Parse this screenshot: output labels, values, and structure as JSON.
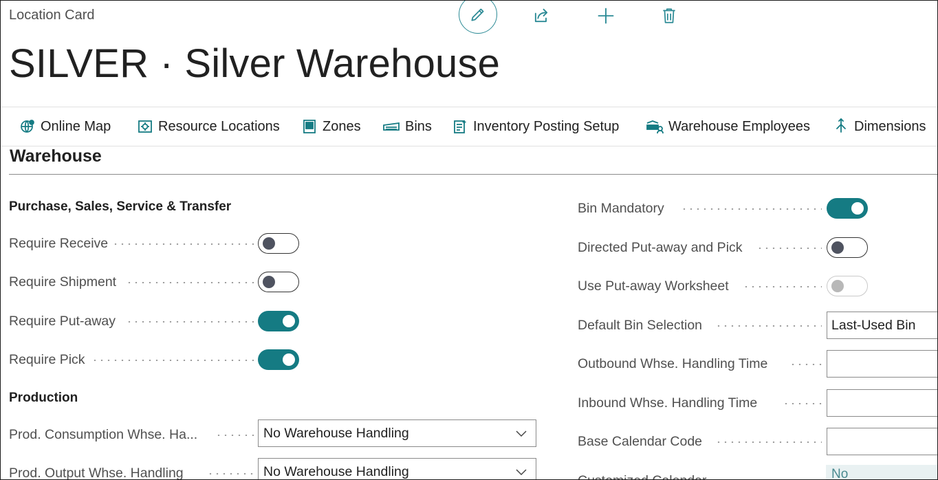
{
  "breadcrumb": "Location Card",
  "actions": {
    "edit": "pencil-icon",
    "share": "share-icon",
    "add": "plus-icon",
    "delete": "trash-icon"
  },
  "title": "SILVER · Silver Warehouse",
  "nav": [
    {
      "label": "Online Map",
      "icon": "globe-map-icon"
    },
    {
      "label": "Resource Locations",
      "icon": "resource-location-icon"
    },
    {
      "label": "Zones",
      "icon": "zones-icon"
    },
    {
      "label": "Bins",
      "icon": "bins-icon"
    },
    {
      "label": "Inventory Posting Setup",
      "icon": "posting-setup-icon"
    },
    {
      "label": "Warehouse Employees",
      "icon": "employees-icon"
    },
    {
      "label": "Dimensions",
      "icon": "dimensions-icon"
    }
  ],
  "section": {
    "title": "Warehouse"
  },
  "left": {
    "group1_title": "Purchase, Sales, Service & Transfer",
    "require_receive": {
      "label": "Require Receive",
      "value": false
    },
    "require_shipment": {
      "label": "Require Shipment",
      "value": false
    },
    "require_putaway": {
      "label": "Require Put-away",
      "value": true
    },
    "require_pick": {
      "label": "Require Pick",
      "value": true
    },
    "group2_title": "Production",
    "prod_consumption": {
      "label": "Prod. Consumption Whse. Ha...",
      "value": "No Warehouse Handling"
    },
    "prod_output": {
      "label": "Prod. Output Whse. Handling",
      "value": "No Warehouse Handling"
    }
  },
  "right": {
    "bin_mandatory": {
      "label": "Bin Mandatory",
      "value": true
    },
    "directed_putaway": {
      "label": "Directed Put-away and Pick",
      "value": false
    },
    "putaway_worksheet": {
      "label": "Use Put-away Worksheet",
      "value": false,
      "disabled": true
    },
    "default_bin_selection": {
      "label": "Default Bin Selection",
      "value": "Last-Used Bin"
    },
    "outbound_handling": {
      "label": "Outbound Whse. Handling Time",
      "value": ""
    },
    "inbound_handling": {
      "label": "Inbound Whse. Handling Time",
      "value": ""
    },
    "base_calendar": {
      "label": "Base Calendar Code",
      "value": ""
    },
    "customized_calendar": {
      "label": "Customized Calendar",
      "value": "No"
    }
  },
  "colors": {
    "accent": "#157b83",
    "edit_ring": "#2b8a95"
  }
}
